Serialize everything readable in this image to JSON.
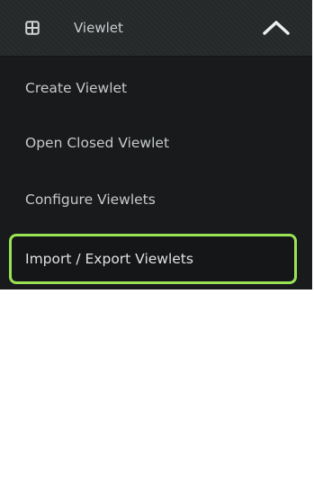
{
  "menu": {
    "title": "Viewlet",
    "header_icon": "grid-icon",
    "toggle_icon": "chevron-up-icon",
    "items": [
      {
        "label": "Create Viewlet"
      },
      {
        "label": "Open Closed Viewlet"
      },
      {
        "label": "Configure Viewlets"
      },
      {
        "label": "Import / Export Viewlets",
        "highlighted": true
      }
    ]
  },
  "colors": {
    "menu_background": "#181a1b",
    "header_background": "#26292a",
    "highlight_border": "#9be356",
    "text": "#c7cacc"
  }
}
